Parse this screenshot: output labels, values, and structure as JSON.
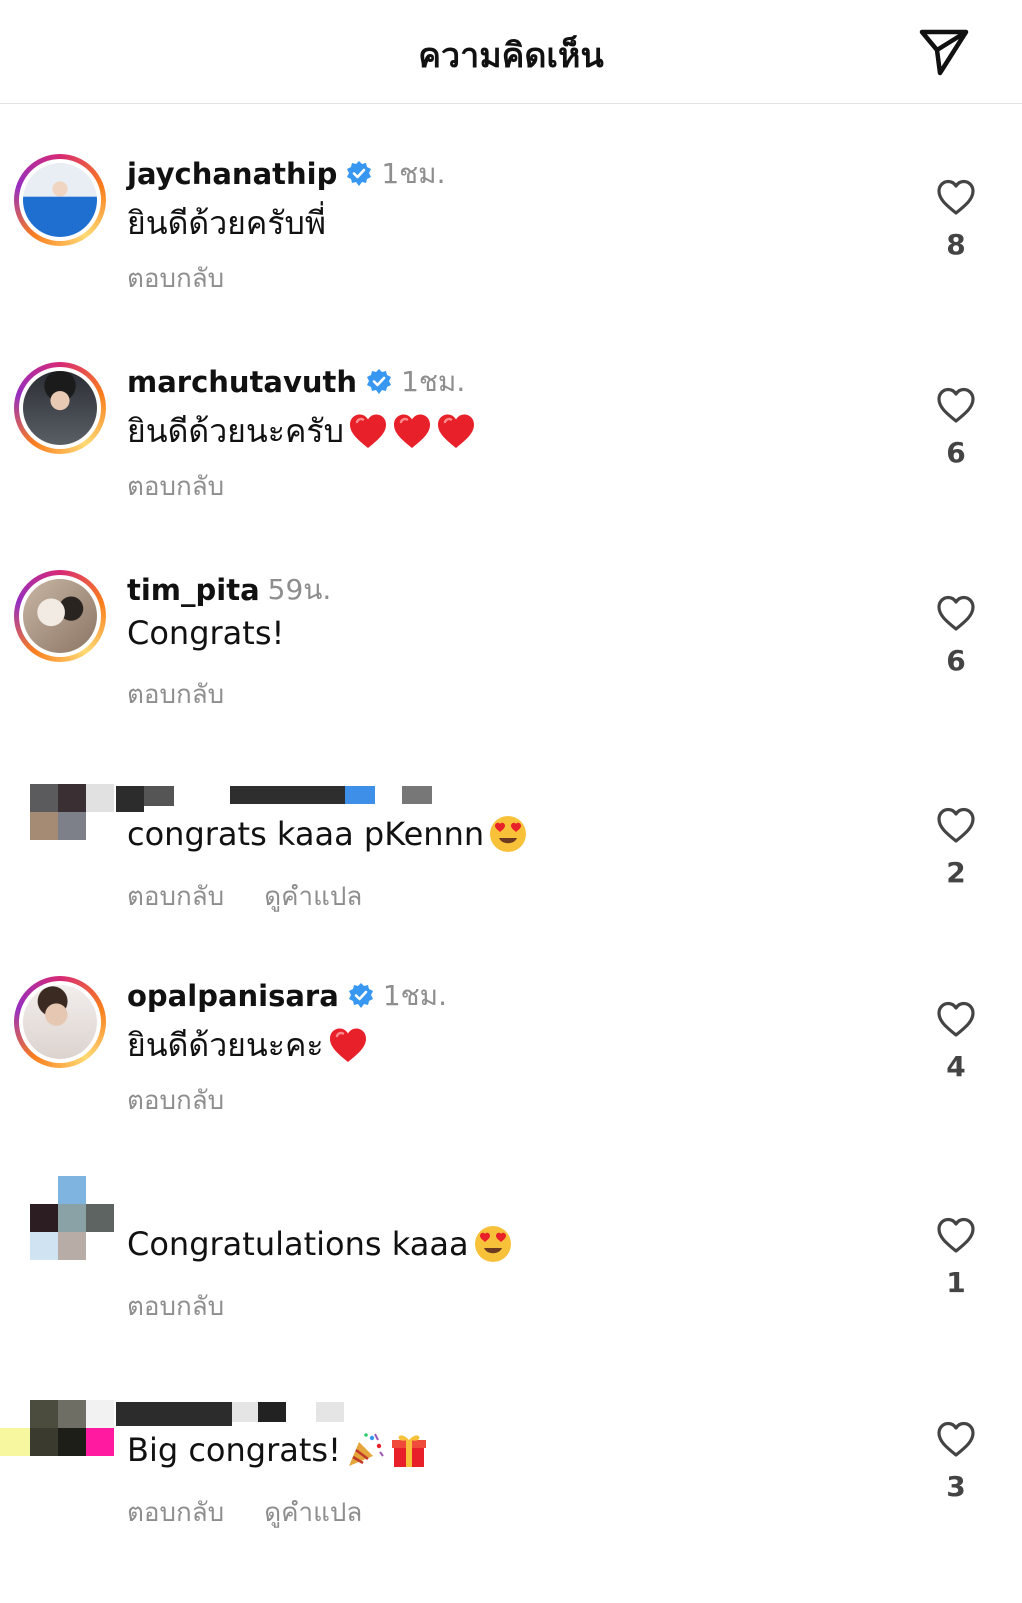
{
  "header": {
    "title": "ความคิดเห็น"
  },
  "actions": {
    "reply": "ตอบกลับ",
    "translate": "ดูคำแปล"
  },
  "comments": [
    {
      "username": "jaychanathip",
      "verified": true,
      "time": "1ชม.",
      "text": "ยินดีด้วยครับพี่",
      "emojis": [],
      "likes": "8",
      "show_translate": false
    },
    {
      "username": "marchutavuth",
      "verified": true,
      "time": "1ชม.",
      "text": "ยินดีด้วยนะครับ",
      "emojis": [
        "red-heart",
        "red-heart",
        "red-heart"
      ],
      "likes": "6",
      "show_translate": false
    },
    {
      "username": "tim_pita",
      "verified": false,
      "time": "59น.",
      "text": "Congrats!",
      "emojis": [],
      "likes": "6",
      "show_translate": false
    },
    {
      "username": "",
      "verified": false,
      "time": "",
      "text": "congrats kaaa pKennn",
      "emojis": [
        "heart-eyes"
      ],
      "likes": "2",
      "show_translate": true
    },
    {
      "username": "opalpanisara",
      "verified": true,
      "time": "1ชม.",
      "text": "ยินดีด้วยนะคะ",
      "emojis": [
        "red-heart"
      ],
      "likes": "4",
      "show_translate": false
    },
    {
      "username": "",
      "verified": false,
      "time": "",
      "text": "Congratulations kaaa",
      "emojis": [
        "heart-eyes"
      ],
      "likes": "1",
      "show_translate": false
    },
    {
      "username": "",
      "verified": false,
      "time": "",
      "text": "Big congrats!",
      "emojis": [
        "party-popper",
        "gift"
      ],
      "likes": "3",
      "show_translate": true
    }
  ],
  "colors": {
    "accent_verified": "#3897f0",
    "muted_text": "#8e8e8e",
    "heart_red": "#e8202a"
  },
  "icons": {
    "share": "paper-plane-icon",
    "like": "heart-outline-icon",
    "verified": "verified-badge-icon"
  }
}
